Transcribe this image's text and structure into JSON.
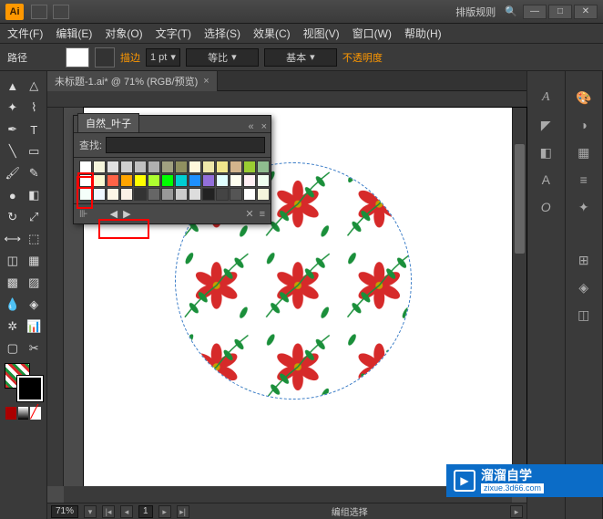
{
  "title_dropdown": "排版规则",
  "menu": [
    "文件(F)",
    "编辑(E)",
    "对象(O)",
    "文字(T)",
    "选择(S)",
    "效果(C)",
    "视图(V)",
    "窗口(W)",
    "帮助(H)"
  ],
  "controlbar": {
    "mode": "路径",
    "stroke_label": "描边",
    "stroke_value": "1 pt",
    "uniform": "等比",
    "basic": "基本",
    "opacity": "不透明度"
  },
  "tab": {
    "name": "未标题-1.ai* @ 71% (RGB/预览)"
  },
  "panel": {
    "title": "自然_叶子",
    "search_label": "查找:",
    "search_value": ""
  },
  "statusbar": {
    "zoom": "71%",
    "page": "1",
    "selection": "编组选择"
  },
  "watermark": {
    "cn": "溜溜自学",
    "url": "zixue.3d66.com"
  },
  "swatch_colors": [
    "#ffffff",
    "#f5f5dc",
    "#e0e0e0",
    "#d0d0d0",
    "#c0c0c0",
    "#b0b0b0",
    "#a0a080",
    "#909060",
    "#fff8dc",
    "#eee8aa",
    "#f0e68c",
    "#d2b48c",
    "#9acd32",
    "#8fbc8f",
    "#ffffff",
    "#fafad2",
    "#ff6347",
    "#ffa500",
    "#ffff00",
    "#adff2f",
    "#00ff00",
    "#00ced1",
    "#1e90ff",
    "#9370db",
    "#e0ffff",
    "#fffff0",
    "#fff0f5",
    "#f0fff0",
    "#f5fffa",
    "#f0f8ff",
    "#fdf5e6",
    "#faf0e6",
    "#333333",
    "#666666",
    "#999999",
    "#cccccc",
    "#dddddd",
    "#222222",
    "#444444",
    "#555555"
  ],
  "chart_data": null
}
